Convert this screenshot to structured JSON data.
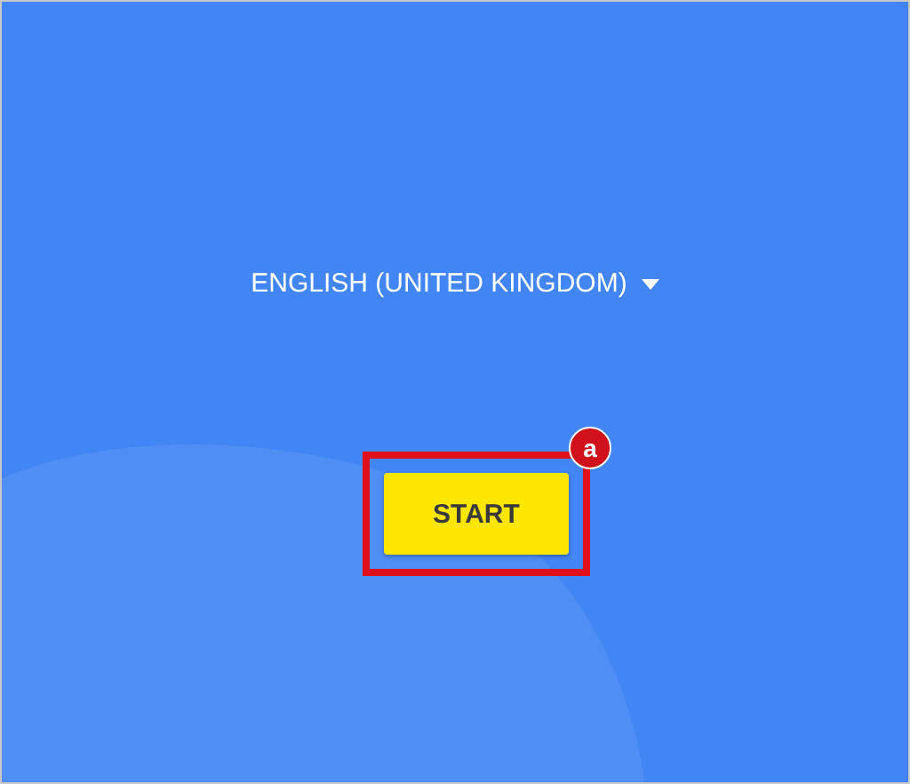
{
  "language_selector": {
    "label": "ENGLISH (UNITED KINGDOM)"
  },
  "start_button": {
    "label": "START"
  },
  "annotation": {
    "badge": "a"
  }
}
